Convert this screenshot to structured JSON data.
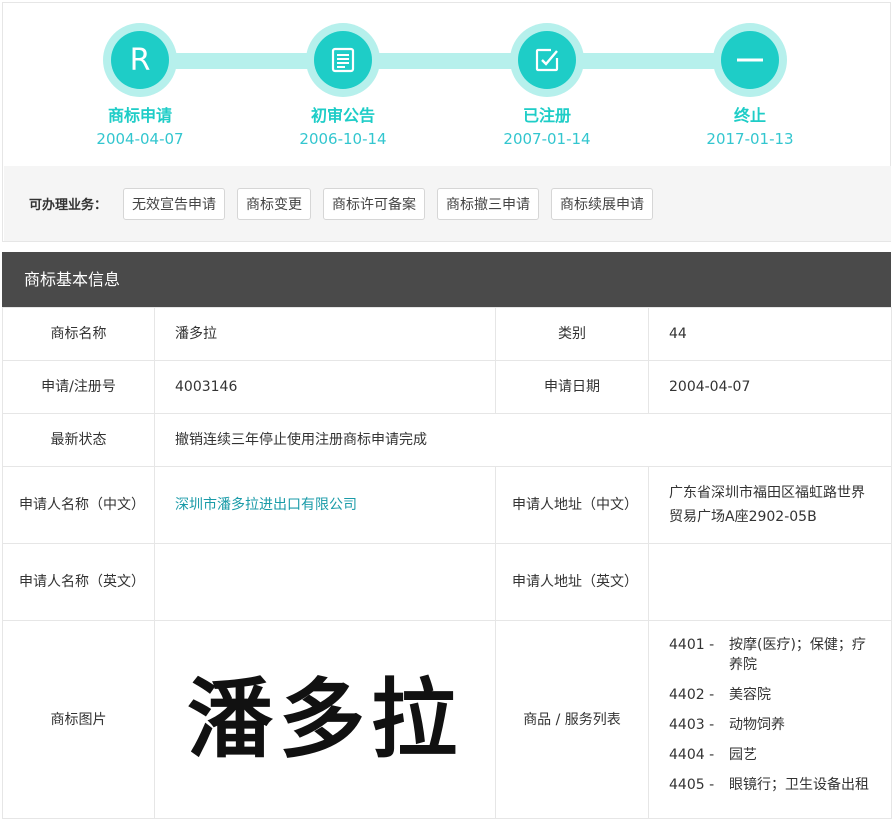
{
  "steps": [
    {
      "label": "商标申请",
      "date": "2004-04-07",
      "icon": "r-letter-icon",
      "glyph": "R"
    },
    {
      "label": "初审公告",
      "date": "2006-10-14",
      "icon": "document-list-icon"
    },
    {
      "label": "已注册",
      "date": "2007-01-14",
      "icon": "checkbox-edit-icon"
    },
    {
      "label": "终止",
      "date": "2017-01-13",
      "icon": "minus-icon"
    }
  ],
  "services": {
    "title": "可办理业务：",
    "buttons": [
      "无效宣告申请",
      "商标变更",
      "商标许可备案",
      "商标撤三申请",
      "商标续展申请"
    ]
  },
  "section_title": "商标基本信息",
  "info": {
    "name_label": "商标名称",
    "name_value": "潘多拉",
    "class_label": "类别",
    "class_value": "44",
    "reg_label": "申请/注册号",
    "reg_value": "4003146",
    "date_label": "申请日期",
    "date_value": "2004-04-07",
    "status_label": "最新状态",
    "status_value": "撤销连续三年停止使用注册商标申请完成",
    "applicant_cn_label": "申请人名称（中文）",
    "applicant_cn_value": "深圳市潘多拉进出口有限公司",
    "address_cn_label": "申请人地址（中文）",
    "address_cn_value": "广东省深圳市福田区福虹路世界贸易广场A座2902-05B",
    "applicant_en_label": "申请人名称（英文）",
    "applicant_en_value": "",
    "address_en_label": "申请人地址（英文）",
    "address_en_value": "",
    "image_label": "商标图片",
    "image_text": "潘多拉",
    "goods_label": "商品 / 服务列表"
  },
  "goods": [
    {
      "code": "4401 -",
      "name": "按摩(医疗)；保健；疗养院"
    },
    {
      "code": "4402 -",
      "name": "美容院"
    },
    {
      "code": "4403 -",
      "name": "动物饲养"
    },
    {
      "code": "4404 -",
      "name": "园艺"
    },
    {
      "code": "4405 -",
      "name": "眼镜行；卫生设备出租"
    }
  ],
  "colors": {
    "accent": "#1ecdc7",
    "accent_light": "#b6f0ec",
    "header_bg": "#4a4a4a",
    "link": "#1a9ba8"
  }
}
